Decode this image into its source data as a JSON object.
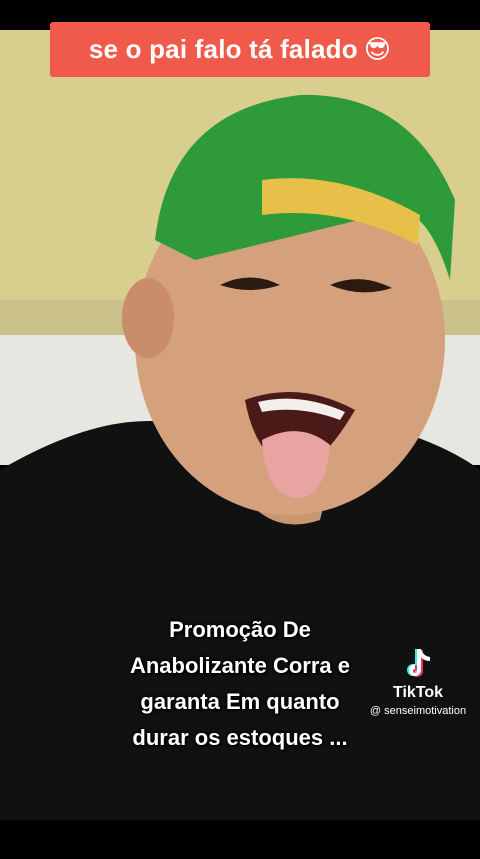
{
  "top_caption": {
    "text": "se o pai falo tá falado",
    "emoji": "😎"
  },
  "subtitle": {
    "lines": [
      "Promoção De",
      "Anabolizante Corra e",
      "garanta Em quanto",
      "durar os estoques ..."
    ]
  },
  "watermark": {
    "brand": "TikTok",
    "handle": "@ senseimotivation"
  },
  "colors": {
    "caption_bg": "#f05a4a",
    "cap_green": "#2f9a3a",
    "cap_brim_yellow": "#e7c04a"
  }
}
